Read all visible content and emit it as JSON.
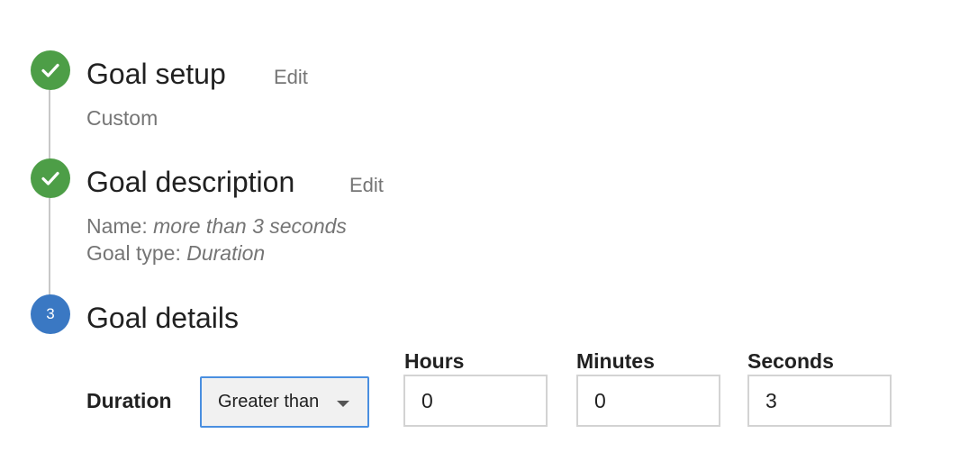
{
  "steps": [
    {
      "status": "complete",
      "title": "Goal setup",
      "edit_label": "Edit",
      "summary": "Custom"
    },
    {
      "status": "complete",
      "title": "Goal description",
      "edit_label": "Edit",
      "name_label": "Name:",
      "name_value": "more than 3 seconds",
      "type_label": "Goal type:",
      "type_value": "Duration"
    },
    {
      "status": "active",
      "number": "3",
      "title": "Goal details"
    }
  ],
  "duration": {
    "label": "Duration",
    "comparison": "Greater than",
    "hours_label": "Hours",
    "hours_value": "0",
    "minutes_label": "Minutes",
    "minutes_value": "0",
    "seconds_label": "Seconds",
    "seconds_value": "3"
  },
  "colors": {
    "complete": "#4d9e47",
    "active": "#3a78c3",
    "focus_border": "#4a8fe0"
  },
  "icons": {
    "complete": "checkmark-icon",
    "dropdown": "caret-down-icon"
  }
}
